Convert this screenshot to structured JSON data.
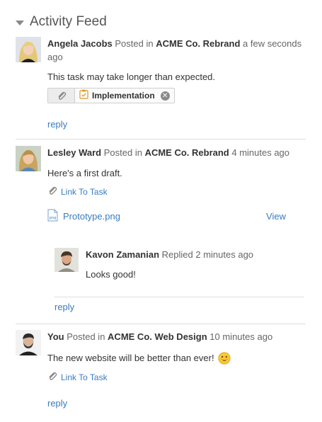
{
  "header": {
    "title": "Activity Feed"
  },
  "posts": [
    {
      "author": "Angela Jacobs",
      "action": "Posted in",
      "project": "ACME Co. Rebrand",
      "time": "a few seconds ago",
      "message": "This task may take longer than expected.",
      "task_tag": "Implementation",
      "reply_label": "reply"
    },
    {
      "author": "Lesley Ward",
      "action": "Posted in",
      "project": "ACME Co. Rebrand",
      "time": "4 minutes ago",
      "message": "Here's a first draft.",
      "link_task_label": "Link To Task",
      "attachment": {
        "name": "Prototype.png",
        "view_label": "View",
        "type": "png"
      },
      "replies": [
        {
          "author": "Kavon Zamanian",
          "action": "Replied",
          "time": "2 minutes ago",
          "message": "Looks good!"
        }
      ],
      "reply_label": "reply"
    },
    {
      "author": "You",
      "action": "Posted in",
      "project": "ACME Co. Web Design",
      "time": "10 minutes ago",
      "message": "The new website will be better than ever!",
      "emoji": "smiley-face",
      "link_task_label": "Link To Task",
      "reply_label": "reply"
    }
  ],
  "colors": {
    "link": "#3a7cc0",
    "divider": "#dedede",
    "text": "#333333",
    "muted": "#666666"
  }
}
